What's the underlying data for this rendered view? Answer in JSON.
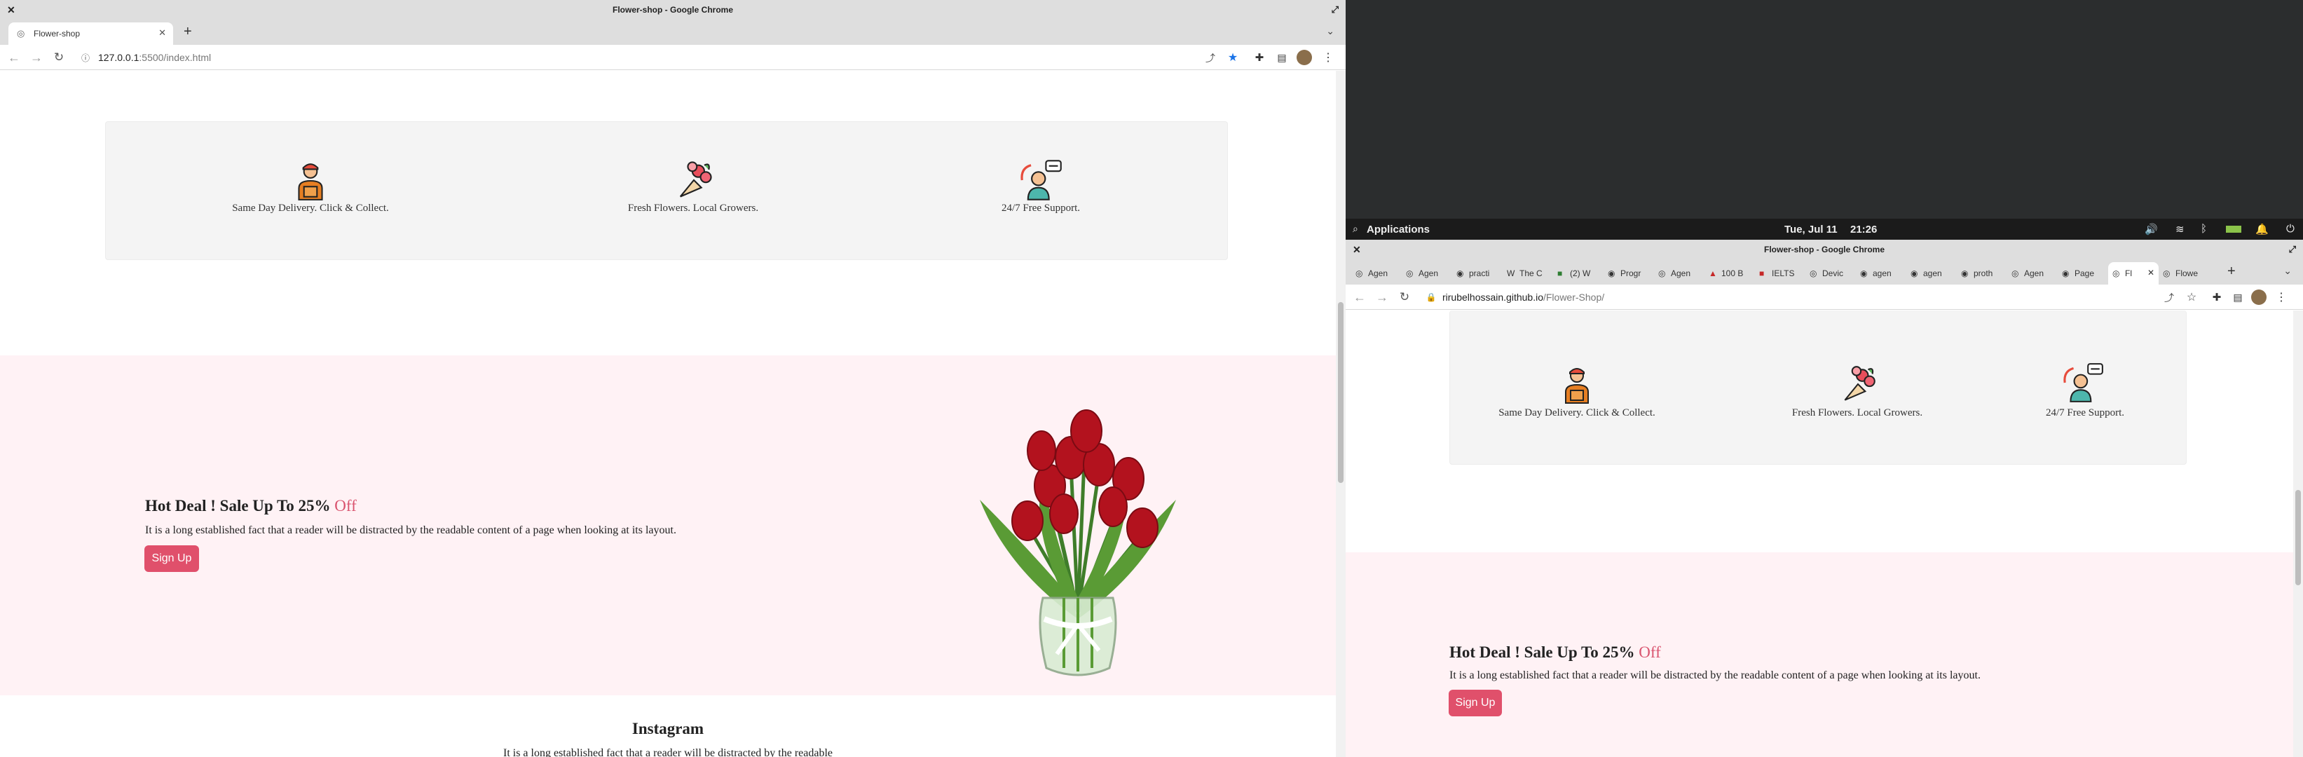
{
  "left_window": {
    "title": "Flower-shop - Google Chrome",
    "tab_label": "Flower-shop",
    "url_host": "127.0.0.1",
    "url_rest": ":5500/index.html",
    "features": [
      {
        "label": "Same Day Delivery. Click & Collect.",
        "icon": "delivery-man-icon"
      },
      {
        "label": "Fresh Flowers. Local Growers.",
        "icon": "flower-bouquet-icon"
      },
      {
        "label": "24/7 Free Support.",
        "icon": "support-agent-icon"
      }
    ],
    "deal_title": "Hot Deal ! Sale Up To 25%",
    "deal_title_accent": "Off",
    "deal_desc": "It is a long established fact that a reader will be distracted by the readable content of a page when looking at its layout.",
    "signup_label": "Sign Up",
    "instagram_title": "Instagram",
    "instagram_desc": "It is a long established fact that a reader will be distracted by the readable"
  },
  "desktop_panel": {
    "applications_label": "Applications",
    "date": "Tue, Jul 11",
    "time": "21:26"
  },
  "right_window": {
    "title": "Flower-shop - Google Chrome",
    "tabs": [
      "Agen",
      "Agen",
      "practi",
      "The C",
      "(2) W",
      "Progr",
      "Agen",
      "100 B",
      "IELTS",
      "Devic",
      "agen",
      "agen",
      "proth",
      "Agen",
      "Page",
      "Fl",
      "Flowe"
    ],
    "url_host": "rirubelhossain.github.io",
    "url_rest": "/Flower-Shop/",
    "features": [
      {
        "label": "Same Day Delivery. Click & Collect."
      },
      {
        "label": "Fresh Flowers. Local Growers."
      },
      {
        "label": "24/7 Free Support."
      }
    ],
    "deal_title": "Hot Deal ! Sale Up To 25%",
    "deal_title_accent": "Off",
    "deal_desc": "It is a long established fact that a reader will be distracted by the readable content of a page when looking at its layout.",
    "signup_label": "Sign Up"
  },
  "colors": {
    "accent": "#e0506b",
    "pink_bg": "#fff2f5",
    "feature_bg": "#f4f4f4"
  }
}
